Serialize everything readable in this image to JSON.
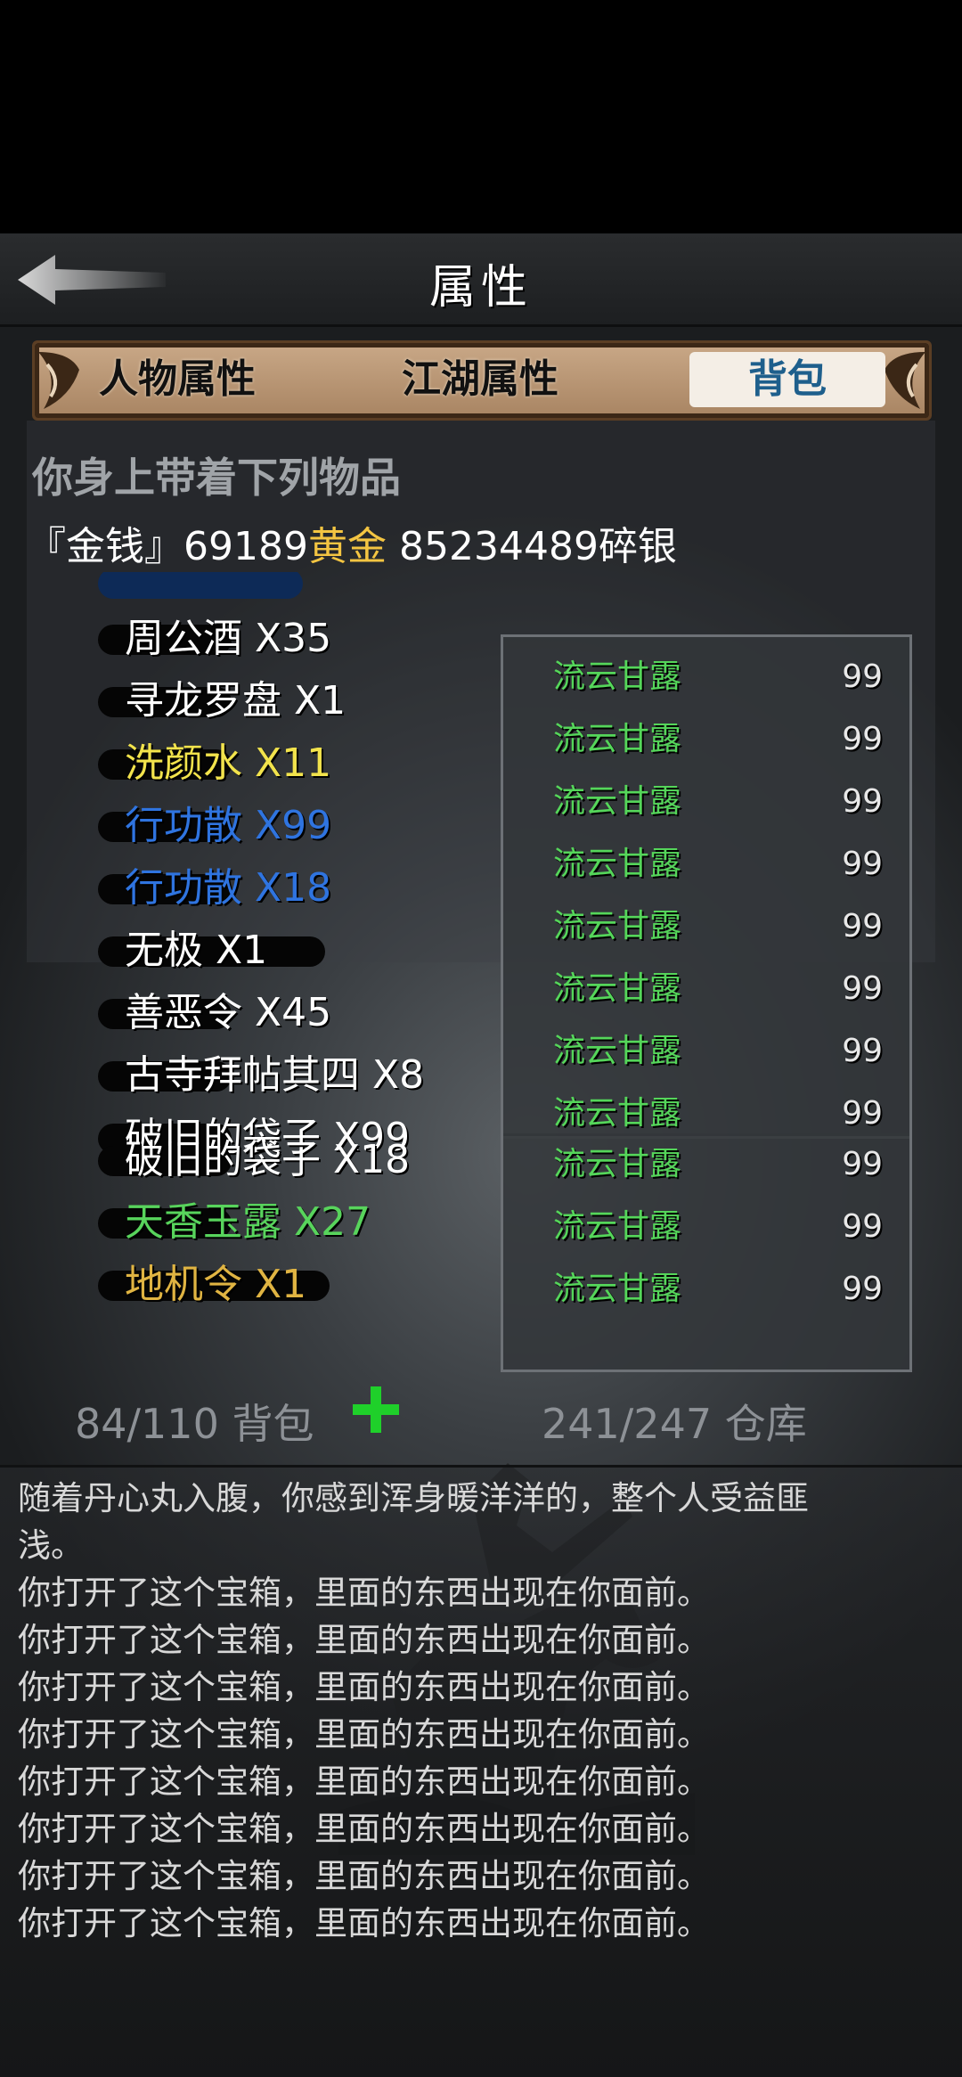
{
  "header": {
    "title": "属性"
  },
  "tabs": [
    "人物属性",
    "江湖属性",
    "背包"
  ],
  "inventory": {
    "heading": "你身上带着下列物品",
    "money": {
      "prefix": "『金钱』",
      "gold_value": "69189",
      "gold_unit": "黄金",
      "silver": "85234489碎银"
    },
    "items": [
      {
        "label": "周公酒 X35",
        "color": "#ffffff"
      },
      {
        "label": "寻龙罗盘 X1",
        "color": "#ffffff"
      },
      {
        "label": "洗颜水 X11",
        "color": "#f2e34c"
      },
      {
        "label": "行功散 X99",
        "color": "#2f74e0"
      },
      {
        "label": "行功散 X18",
        "color": "#2f74e0"
      },
      {
        "label": "无极 X1",
        "color": "#ffffff"
      },
      {
        "label": "善恶令 X45",
        "color": "#ffffff"
      },
      {
        "label": "古寺拜帖其四 X8",
        "color": "#ffffff"
      },
      {
        "label": "破旧的袋子 X99",
        "color": "#ffffff"
      },
      {
        "label": "破旧的袋子 X18",
        "color": "#ffffff"
      },
      {
        "label": "天香玉露 X27",
        "color": "#58d45c"
      },
      {
        "label": "地机令 X1",
        "color": "#e0b442"
      }
    ],
    "storage": [
      {
        "name": "流云甘露",
        "qty": "99"
      },
      {
        "name": "流云甘露",
        "qty": "99"
      },
      {
        "name": "流云甘露",
        "qty": "99"
      },
      {
        "name": "流云甘露",
        "qty": "99"
      },
      {
        "name": "流云甘露",
        "qty": "99"
      },
      {
        "name": "流云甘露",
        "qty": "99"
      },
      {
        "name": "流云甘露",
        "qty": "99"
      },
      {
        "name": "流云甘露",
        "qty": "99"
      },
      {
        "name": "流云甘露",
        "qty": "99"
      },
      {
        "name": "流云甘露",
        "qty": "99"
      },
      {
        "name": "流云甘露",
        "qty": "99"
      }
    ],
    "bag_count": "84/110 背包",
    "storage_count": "241/247 仓库"
  },
  "log": [
    "随着丹心丸入腹，你感到浑身暖洋洋的，整个人受益匪",
    "浅。",
    "你打开了这个宝箱，里面的东西出现在你面前。",
    "你打开了这个宝箱，里面的东西出现在你面前。",
    "你打开了这个宝箱，里面的东西出现在你面前。",
    "你打开了这个宝箱，里面的东西出现在你面前。",
    "你打开了这个宝箱，里面的东西出现在你面前。",
    "你打开了这个宝箱，里面的东西出现在你面前。",
    "你打开了这个宝箱，里面的东西出现在你面前。",
    "你打开了这个宝箱，里面的东西出现在你面前。"
  ]
}
